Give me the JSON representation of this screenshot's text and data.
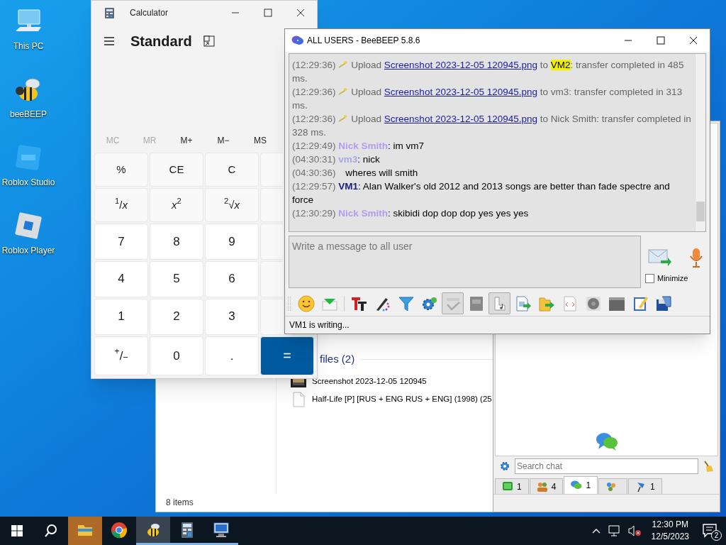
{
  "desktop_icons": [
    {
      "kind": "computer",
      "label": "This PC"
    },
    {
      "kind": "bee",
      "label": "beeBEEP"
    },
    {
      "kind": "studio",
      "label": "Roblox Studio"
    },
    {
      "kind": "player",
      "label": "Roblox Player"
    }
  ],
  "explorer": {
    "group": "files (2)",
    "files": [
      {
        "kind": "image",
        "name": "Screenshot 2023-12-05 120945"
      },
      {
        "kind": "document",
        "name": "Half-Life [P] [RUS + ENG RUS + ENG] (1998) (25"
      }
    ],
    "status": "8 items"
  },
  "beebeep_main": {
    "search": {
      "placeholder": "Search chat"
    },
    "tabs": [
      {
        "kind": "computer",
        "count": "1",
        "selected": false
      },
      {
        "kind": "users",
        "count": "4",
        "selected": false
      },
      {
        "kind": "chats",
        "count": "1",
        "selected": true
      },
      {
        "kind": "groups",
        "selected": false
      },
      {
        "kind": "files",
        "count": "1",
        "selected": false
      }
    ]
  },
  "calculator": {
    "title": "Calculator",
    "mode": "Standard",
    "memory": [
      {
        "label": "MC",
        "disabled": true
      },
      {
        "label": "MR",
        "disabled": true
      },
      {
        "label": "M+",
        "disabled": false
      },
      {
        "label": "M−",
        "disabled": false
      },
      {
        "label": "MS",
        "disabled": false
      }
    ],
    "keys": [
      {
        "kind": "function",
        "label": "%"
      },
      {
        "kind": "function",
        "label": "CE"
      },
      {
        "kind": "function",
        "label": "C"
      },
      {
        "kind": "covered"
      },
      {
        "kind": "function",
        "label": "$^{1}$/*x*"
      },
      {
        "kind": "function",
        "label": "*x*$^{2}$"
      },
      {
        "kind": "function",
        "label": "$^{2}$√*x*"
      },
      {
        "kind": "covered"
      },
      {
        "kind": "digit",
        "label": "7"
      },
      {
        "kind": "digit",
        "label": "8"
      },
      {
        "kind": "digit",
        "label": "9"
      },
      {
        "kind": "covered"
      },
      {
        "kind": "digit",
        "label": "4"
      },
      {
        "kind": "digit",
        "label": "5"
      },
      {
        "kind": "digit",
        "label": "6"
      },
      {
        "kind": "covered"
      },
      {
        "kind": "digit",
        "label": "1"
      },
      {
        "kind": "digit",
        "label": "2"
      },
      {
        "kind": "digit",
        "label": "3"
      },
      {
        "kind": "covered"
      },
      {
        "kind": "digit",
        "label": "$^{+}$/$_{−}$"
      },
      {
        "kind": "digit",
        "label": "0"
      },
      {
        "kind": "digit",
        "label": "."
      },
      {
        "kind": "equals",
        "label": "="
      }
    ]
  },
  "chat_window": {
    "title": "ALL USERS - BeeBEEP 5.8.6",
    "messages": [
      {
        "kind": "upload",
        "time": "(12:29:36)",
        "action": "Upload",
        "file": "Screenshot 2023-12-05 120945.png",
        "to": "to",
        "recipient": "VM2",
        "highlighted": true,
        "result": ": transfer completed in 485 ms."
      },
      {
        "kind": "upload",
        "time": "(12:29:36)",
        "action": "Upload",
        "file": "Screenshot 2023-12-05 120945.png",
        "to": "to",
        "recipient": "vm3",
        "highlighted": false,
        "result": ": transfer completed in 313 ms."
      },
      {
        "kind": "upload",
        "time": "(12:29:36)",
        "action": "Upload",
        "file": "Screenshot 2023-12-05 120945.png",
        "to": "to",
        "recipient": "Nick Smith",
        "highlighted": false,
        "result": ": transfer completed in 328 ms."
      },
      {
        "kind": "chat",
        "time": "(12:29:49)",
        "sender": "Nick Smith",
        "color": "#b39cf0",
        "text": ": im vm7"
      },
      {
        "kind": "chat",
        "time": "(04:30:31)",
        "sender": "vm3",
        "color": "#a8a8e6",
        "text": ": nick"
      },
      {
        "kind": "chat",
        "time": "(04:30:36)",
        "text": "wheres will smith"
      },
      {
        "kind": "chat",
        "time": "(12:29:57)",
        "sender": "VM1",
        "color": "#1c1a78",
        "text": ": Alan Walker's old 2012 and 2013 songs are better than fade spectre and force"
      },
      {
        "kind": "chat",
        "time": "(12:30:29)",
        "sender": "Nick Smith",
        "color": "#b39cf0",
        "text": ": skibidi dop dop dop yes yes yes"
      }
    ],
    "input": {
      "placeholder": "Write a message to all user"
    },
    "minimize": {
      "label": "Minimize",
      "checked": false
    },
    "toolbar": [
      {
        "kind": "smiley",
        "pressed": false
      },
      {
        "kind": "inbox",
        "pressed": false
      },
      {
        "kind": "font",
        "pressed": false
      },
      {
        "kind": "pencil",
        "pressed": false
      },
      {
        "kind": "filter",
        "pressed": false
      },
      {
        "kind": "gears",
        "pressed": false
      },
      {
        "kind": "spellcheck",
        "pressed": true
      },
      {
        "kind": "book",
        "pressed": false
      },
      {
        "kind": "sound",
        "pressed": true
      },
      {
        "kind": "send-file",
        "pressed": false
      },
      {
        "kind": "send-folder",
        "pressed": false
      },
      {
        "kind": "code",
        "pressed": false
      },
      {
        "kind": "record",
        "pressed": false
      },
      {
        "kind": "screen",
        "pressed": false
      },
      {
        "kind": "notepad",
        "pressed": false
      },
      {
        "kind": "save",
        "pressed": false
      }
    ],
    "status": "VM1 is writing..."
  },
  "taskbar": {
    "items": [
      {
        "kind": "folder",
        "attention": true,
        "active": false,
        "open": false
      },
      {
        "kind": "chrome",
        "attention": false,
        "active": false,
        "open": false
      },
      {
        "kind": "bee",
        "attention": false,
        "active": true,
        "open": true
      },
      {
        "kind": "calculator",
        "attention": false,
        "active": false,
        "open": true
      },
      {
        "kind": "remote",
        "attention": false,
        "active": false,
        "open": true
      }
    ],
    "time": "12:30 PM",
    "date": "12/5/2023",
    "notifications": "2"
  }
}
